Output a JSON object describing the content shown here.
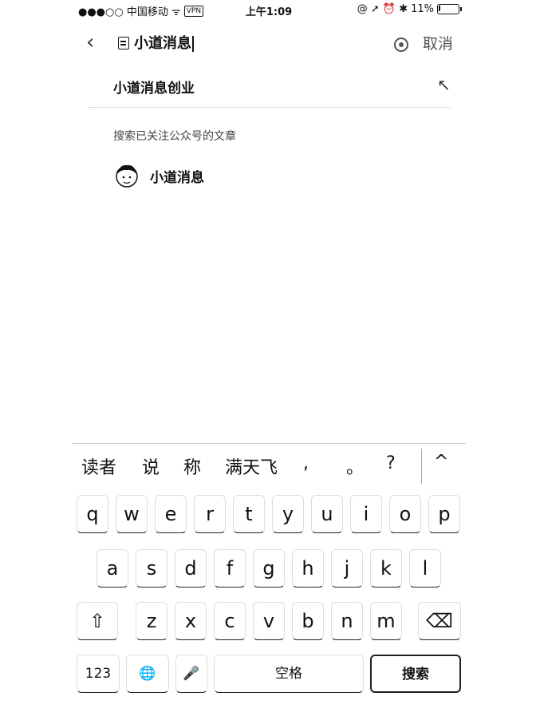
{
  "status": {
    "carrier": "●●●○○ 中国移动",
    "wifi": "ᯤ",
    "vpn": "VPN",
    "time": "上午1:09",
    "icons": "@ ➚ ⏰ ✱",
    "battery_pct_text": "11%",
    "battery_level": 0.11
  },
  "search": {
    "back_icon": "chevron-left",
    "query": "小道消息",
    "cancel_label": "取消"
  },
  "suggestion": {
    "text": "小道消息创业",
    "arrow": "↖"
  },
  "section_title": "搜索已关注公众号的文章",
  "account": {
    "name": "小道消息"
  },
  "keyboard": {
    "candidates": [
      "读者",
      "说",
      "称",
      "满天飞",
      ",",
      "。",
      "?"
    ],
    "collapse": "^",
    "row1": [
      "q",
      "w",
      "e",
      "r",
      "t",
      "y",
      "u",
      "i",
      "o",
      "p"
    ],
    "row2": [
      "a",
      "s",
      "d",
      "f",
      "g",
      "h",
      "j",
      "k",
      "l"
    ],
    "row3": [
      "z",
      "x",
      "c",
      "v",
      "b",
      "n",
      "m"
    ],
    "shift": "⇧",
    "delete": "⌫",
    "num": "123",
    "globe": "🌐",
    "mic": "🎤",
    "space": "空格",
    "action": "搜索"
  }
}
